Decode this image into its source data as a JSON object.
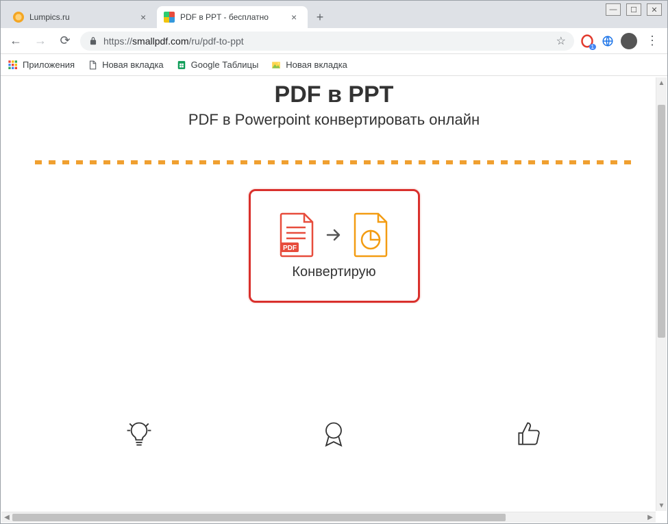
{
  "window_controls": {
    "min": "—",
    "max": "☐",
    "close": "✕"
  },
  "tabs": [
    {
      "title": "Lumpics.ru",
      "favicon_color": "#f4a623",
      "active": false
    },
    {
      "title": "PDF в PPT - бесплатно",
      "favicon_multi": true,
      "active": true
    }
  ],
  "toolbar": {
    "url_scheme": "https://",
    "url_host": "smallpdf.com",
    "url_path": "/ru/pdf-to-ppt",
    "badge_count": "1"
  },
  "bookmarks": [
    {
      "label": "Приложения",
      "icon": "apps"
    },
    {
      "label": "Новая вкладка",
      "icon": "file"
    },
    {
      "label": "Google Таблицы",
      "icon": "sheets"
    },
    {
      "label": "Новая вкладка",
      "icon": "img"
    }
  ],
  "page": {
    "title": "PDF в PPT",
    "subtitle": "PDF в Powerpoint конвертировать онлайн",
    "status": "Конвертирую",
    "pdf_label": "PDF"
  }
}
